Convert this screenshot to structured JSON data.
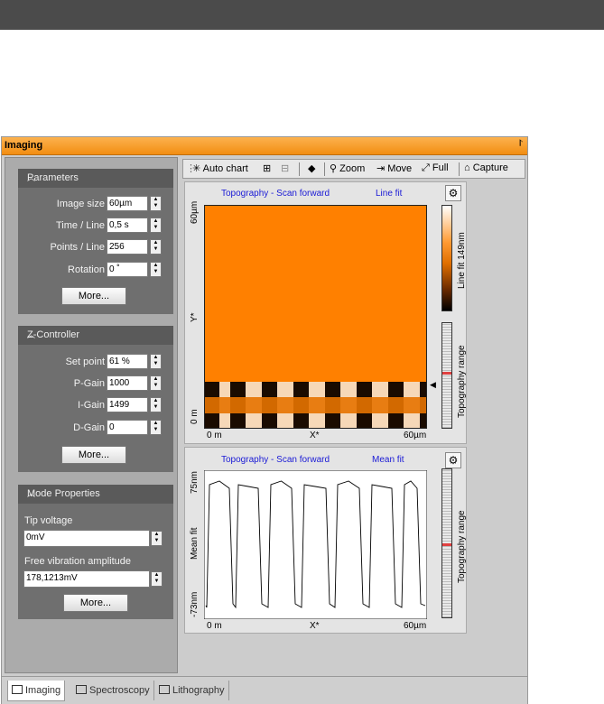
{
  "window_title": "Imaging",
  "pin_glyph": "⨡",
  "parameters": {
    "header": "Parameters",
    "rows": [
      {
        "label": "Image size",
        "value": "60µm"
      },
      {
        "label": "Time / Line",
        "value": "0,5 s"
      },
      {
        "label": "Points / Line",
        "value": "256"
      },
      {
        "label": "Rotation",
        "value": "0 ˚"
      }
    ],
    "more_label": "More..."
  },
  "zcontroller": {
    "header": "Z-Controller",
    "rows": [
      {
        "label": "Set point",
        "value": "61 %"
      },
      {
        "label": "P-Gain",
        "value": "1000"
      },
      {
        "label": "I-Gain",
        "value": "1499"
      },
      {
        "label": "D-Gain",
        "value": "0"
      }
    ],
    "more_label": "More..."
  },
  "mode": {
    "header": "Mode Properties",
    "tip_label": "Tip voltage",
    "tip_value": "0mV",
    "amp_label": "Free vibration amplitude",
    "amp_value": "178,1213mV",
    "more_label": "More..."
  },
  "toolbar": {
    "autochart": "Auto chart",
    "zoom": "Zoom",
    "move": "Move",
    "full": "Full",
    "capture": "Capture"
  },
  "plot1": {
    "title": "Topography - Scan forward",
    "fit": "Line fit",
    "y_top": "60µm",
    "y_mid": "Y*",
    "y_bot": "0 m",
    "x_left": "0 m",
    "x_mid": "X*",
    "x_right": "60µm",
    "colorbar_label": "Line fit 149nm",
    "range_label": "Topography range",
    "image_color": "#ff8000"
  },
  "plot2": {
    "title": "Topography - Scan forward",
    "fit": "Mean fit",
    "y_top": "75nm",
    "y_mid": "Mean fit",
    "y_bot": "-73nm",
    "x_left": "0 m",
    "x_mid": "X*",
    "x_right": "60µm",
    "range_label": "Topography range"
  },
  "tabs": [
    "Imaging",
    "Spectroscopy",
    "Lithography"
  ]
}
